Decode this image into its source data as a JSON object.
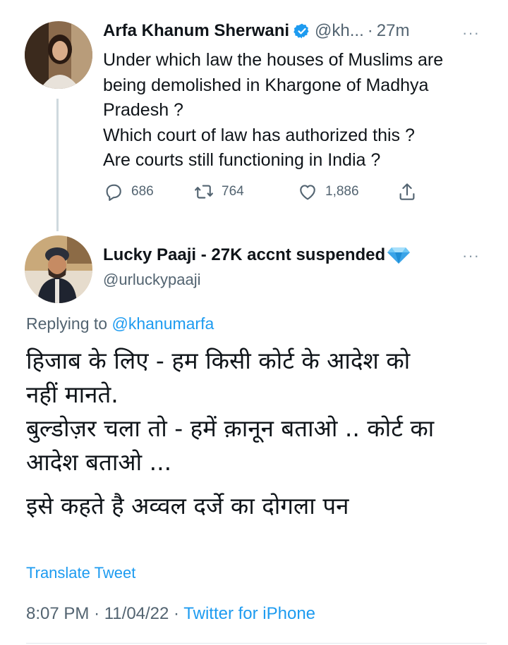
{
  "tweet": {
    "author_name": "Arfa Khanum Sherwani",
    "handle": "@kh...",
    "separator": "·",
    "time": "27m",
    "more_label": "···",
    "lines": [
      "Under which law the houses of Muslims are",
      "being demolished in Khargone of Madhya",
      "Pradesh ?",
      "Which court of law has authorized this ?",
      "Are courts still functioning in India ?"
    ],
    "replies": "686",
    "retweets": "764",
    "likes": "1,886"
  },
  "reply": {
    "author_name": "Lucky Paaji - 27K accnt suspended",
    "handle": "@urluckypaaji",
    "more_label": "···",
    "replying_prefix": "Replying to",
    "replying_to": "@khanumarfa",
    "lines": [
      "हिजाब के लिए  - हम किसी कोर्ट के आदेश को",
      "नहीं मानते.",
      "बुल्डोज़र चला तो - हमें क़ानून बताओ .. कोर्ट का",
      "आदेश बताओ ...",
      "इसे कहते है अव्वल दर्जे का दोगला पन"
    ],
    "translate_label": "Translate Tweet",
    "time": "8:07 PM",
    "separator": "·",
    "date": "11/04/22",
    "source": "Twitter for iPhone"
  },
  "colors": {
    "accent": "#1d9bf0",
    "secondary_text": "#536471",
    "verified": "#1d9bf0"
  },
  "icons": [
    "verified-badge-icon",
    "reply-icon",
    "retweet-icon",
    "like-icon",
    "share-icon",
    "diamond-icon"
  ]
}
